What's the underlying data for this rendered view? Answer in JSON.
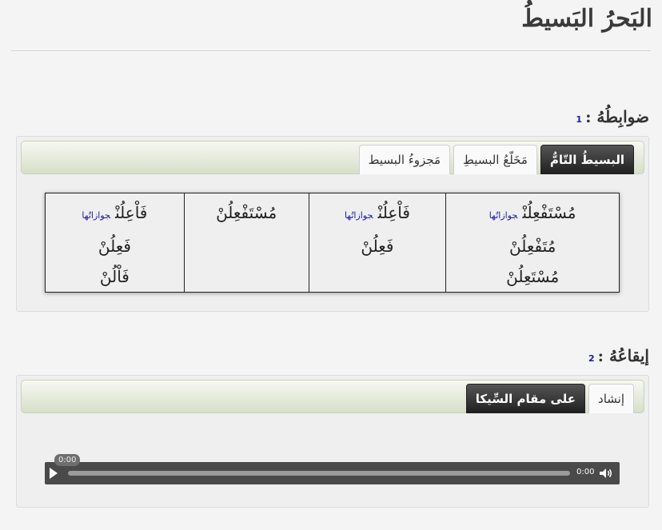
{
  "page": {
    "title": "البَحرُ البَسيطُ"
  },
  "rules_section": {
    "heading": "ضوابِطُهُ :",
    "number": "1",
    "tabs": [
      {
        "label": "البسيطُ التّامُّ",
        "active": true
      },
      {
        "label": "مَخَلّعُ البسيطِ",
        "active": false
      },
      {
        "label": "مَجزوءُ البسيط",
        "active": false
      }
    ],
    "jawazat_label": "جوازاتُها",
    "table": [
      {
        "lines": [
          "مُسْتَفْعِلُنْ",
          "مُتَفْعِلُنْ",
          "مُسْتَعِلُنْ"
        ],
        "has_jawazat": true
      },
      {
        "lines": [
          "فَاْعِلُنْ",
          "فَعِلُنْ"
        ],
        "has_jawazat": true
      },
      {
        "lines": [
          "مُسْتَفْعِلُنْ"
        ],
        "has_jawazat": false
      },
      {
        "lines": [
          "فَاْعِلُنْ",
          "فَعِلُنْ",
          "فَاْلُنْ"
        ],
        "has_jawazat": true
      }
    ]
  },
  "rhythm_section": {
    "heading": "إيقاعُهُ :",
    "number": "2",
    "tabs": [
      {
        "label": "إنشاد",
        "active": false
      },
      {
        "label": "على مقام السِّيكا",
        "active": true
      }
    ],
    "player": {
      "current_time": "0:00",
      "duration": "0:00",
      "progress": 0
    }
  },
  "icons": {
    "play": "play-icon",
    "volume": "volume-icon"
  },
  "colors": {
    "link_blue": "#1a1aa6",
    "active_tab": "#2b2b2b",
    "tabbar_gradient_bottom": "#d7dfc8",
    "player_bg": "#4a4a4a"
  }
}
